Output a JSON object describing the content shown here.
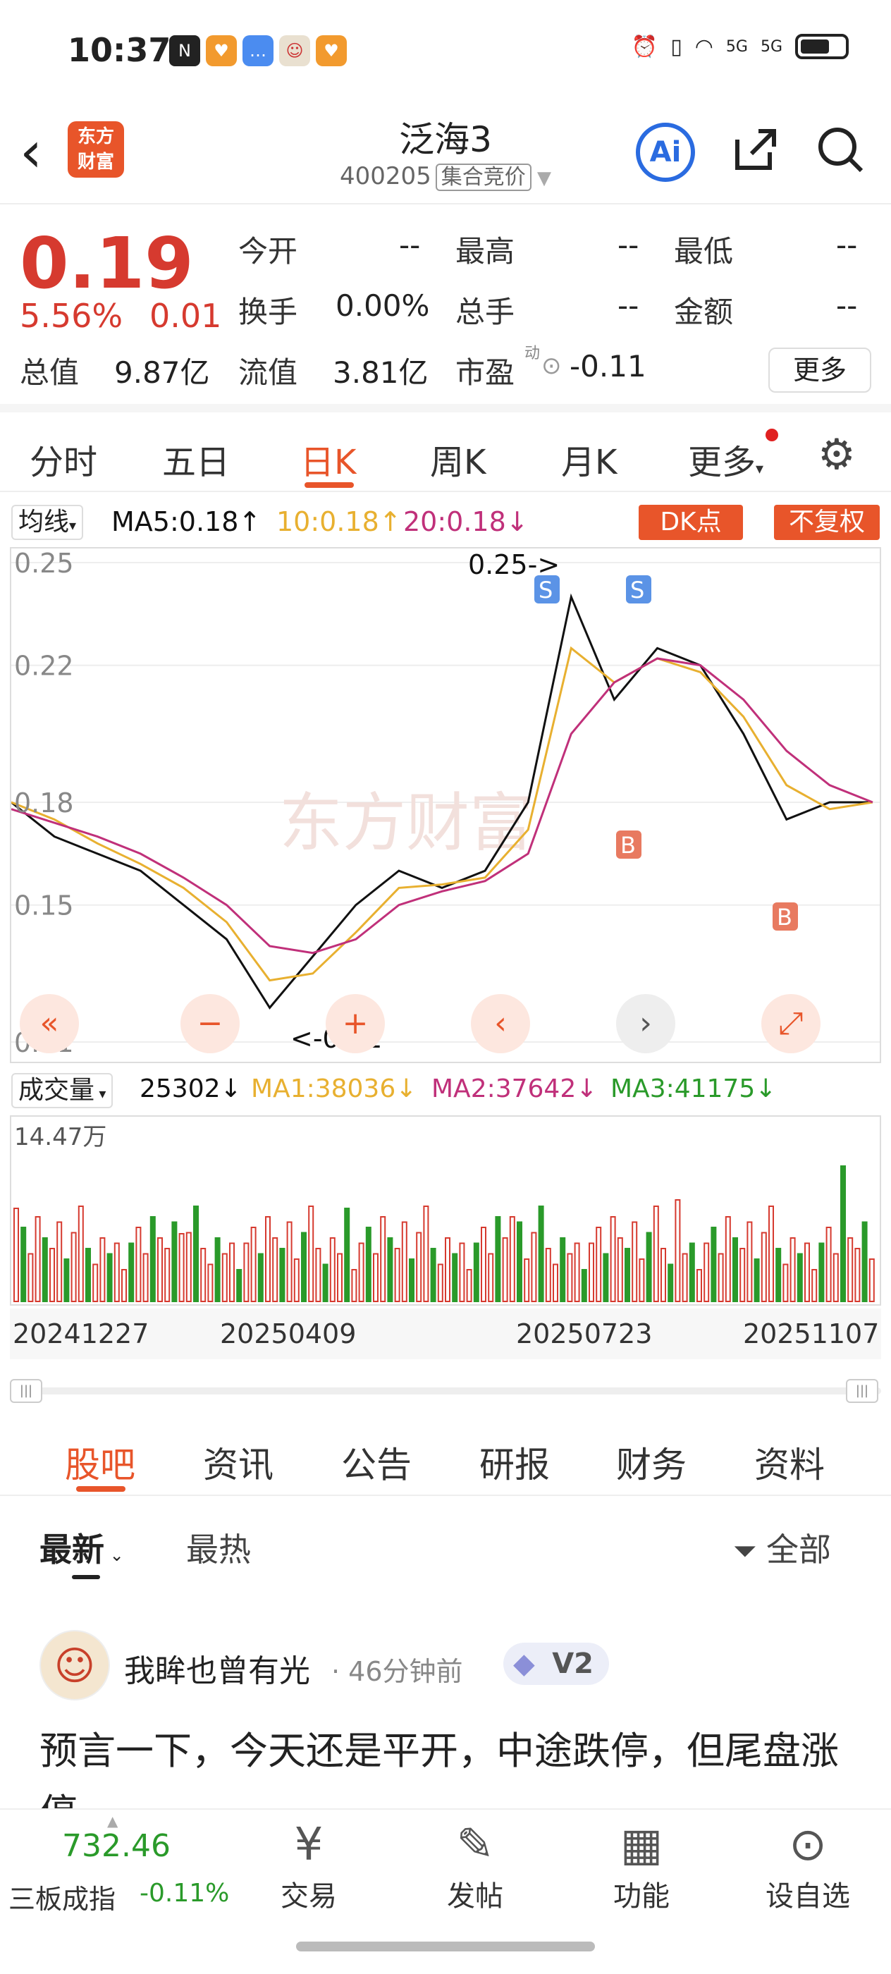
{
  "status_bar": {
    "time": "10:37",
    "net1": "5G",
    "net2": "5G"
  },
  "header": {
    "logo_text": "东方财富",
    "title": "泛海3",
    "code": "400205",
    "code_tag": "集合竞价",
    "ai_label": "Ai"
  },
  "quote": {
    "price": "0.19",
    "change_pct": "5.56%",
    "change_amt": "0.01",
    "open_label": "今开",
    "open_value": "--",
    "high_label": "最高",
    "high_value": "--",
    "low_label": "最低",
    "low_value": "--",
    "turnover_label": "换手",
    "turnover_value": "0.00%",
    "volume_label": "总手",
    "volume_value": "--",
    "amount_label": "金额",
    "amount_value": "--",
    "mktcap_label": "总值",
    "mktcap_value": "9.87亿",
    "float_label": "流值",
    "float_value": "3.81亿",
    "pe_label": "市盈",
    "pe_sup": "动",
    "pe_value": "-0.11",
    "more_label": "更多"
  },
  "chart_tabs": [
    "分时",
    "五日",
    "日K",
    "周K",
    "月K",
    "更多"
  ],
  "ma_legend": {
    "selector": "均线",
    "ma5": "MA5:0.18↑",
    "ma10": "10:0.18↑",
    "ma20": "20:0.18↓",
    "dk_label": "DK点",
    "fq_label": "不复权"
  },
  "price_axis": [
    "0.25",
    "0.22",
    "0.18",
    "0.15",
    "0.11"
  ],
  "annotations": {
    "high": "0.25->",
    "low": "<-0.11",
    "watermark": "东方财富"
  },
  "volume_legend": {
    "selector": "成交量",
    "vol": "25302↓",
    "ma1": "MA1:38036↓",
    "ma2": "MA2:37642↓",
    "ma3": "MA3:41175↓",
    "axis_max": "14.47万"
  },
  "dates": [
    "20241227",
    "20250409",
    "20250723",
    "20251107"
  ],
  "content_tabs": [
    "股吧",
    "资讯",
    "公告",
    "研报",
    "财务",
    "资料"
  ],
  "sort": {
    "latest": "最新",
    "hot": "最热",
    "filter": "全部"
  },
  "post": {
    "author": "我眸也曾有光",
    "time": "· 46分钟前",
    "badge": "V2",
    "text": "预言一下，今天还是平开，中途跌停，但尾盘涨停"
  },
  "bottom_nav": {
    "index_value": "732.46",
    "index_name": "三板成指",
    "index_change": "-0.11%",
    "items": [
      "交易",
      "发帖",
      "功能",
      "设自选"
    ]
  },
  "colors": {
    "accent": "#e8552a",
    "up": "#d63a2f",
    "ma5": "#111111",
    "ma10": "#e8b030",
    "ma20": "#c0307a",
    "down": "#2a9a2a"
  },
  "chart_data": {
    "type": "line",
    "x": [
      "20241227",
      "20250409",
      "20250723",
      "20251107"
    ],
    "series": [
      {
        "name": "MA5",
        "values": [
          0.18,
          0.17,
          0.165,
          0.16,
          0.15,
          0.14,
          0.12,
          0.135,
          0.15,
          0.16,
          0.155,
          0.16,
          0.18,
          0.24,
          0.21,
          0.225,
          0.22,
          0.2,
          0.175,
          0.18,
          0.18
        ]
      },
      {
        "name": "10",
        "values": [
          0.18,
          0.175,
          0.168,
          0.162,
          0.155,
          0.145,
          0.128,
          0.13,
          0.142,
          0.155,
          0.156,
          0.158,
          0.172,
          0.225,
          0.215,
          0.222,
          0.218,
          0.205,
          0.185,
          0.178,
          0.18
        ]
      },
      {
        "name": "20",
        "values": [
          0.178,
          0.174,
          0.17,
          0.165,
          0.158,
          0.15,
          0.138,
          0.136,
          0.14,
          0.15,
          0.154,
          0.157,
          0.165,
          0.2,
          0.215,
          0.222,
          0.22,
          0.21,
          0.195,
          0.185,
          0.18
        ]
      }
    ],
    "ylim": [
      0.11,
      0.25
    ],
    "ticks": [
      "0.25",
      "0.22",
      "0.18",
      "0.15",
      "0.11"
    ]
  }
}
